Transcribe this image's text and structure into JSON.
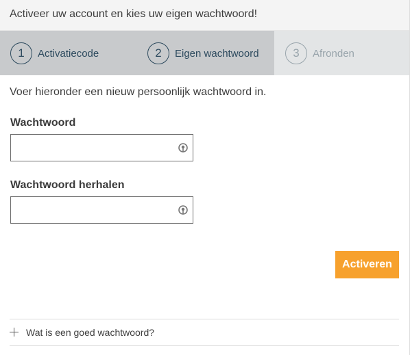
{
  "header": {
    "title": "Activeer uw account en kies uw eigen wachtwoord!"
  },
  "steps": [
    {
      "number": "1",
      "label": "Activatiecode",
      "state": "done"
    },
    {
      "number": "2",
      "label": "Eigen wachtwoord",
      "state": "active"
    },
    {
      "number": "3",
      "label": "Afronden",
      "state": "pending"
    }
  ],
  "form": {
    "intro": "Voer hieronder een nieuw persoonlijk wachtwoord in.",
    "password": {
      "label": "Wachtwoord",
      "value": "",
      "icon": "show-password-icon"
    },
    "password_repeat": {
      "label": "Wachtwoord herhalen",
      "value": "",
      "icon": "show-password-icon"
    },
    "submit_label": "Activeren"
  },
  "faq": {
    "label": "Wat is een goed wachtwoord?",
    "icon": "plus-icon"
  },
  "colors": {
    "accent": "#f7a12d",
    "step_active_bg": "#c8cacc",
    "step_inactive_bg": "#e3e5e6",
    "step_text": "#2d4a5e"
  }
}
